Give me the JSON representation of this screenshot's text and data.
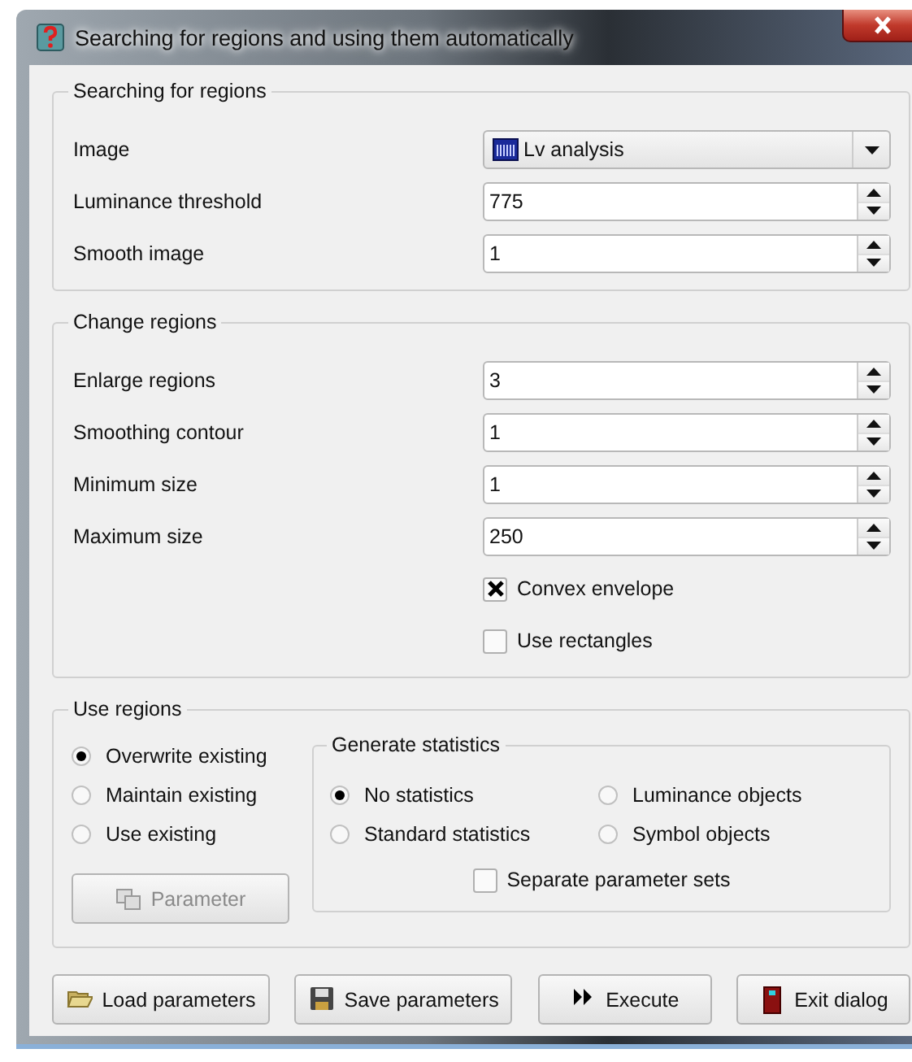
{
  "window": {
    "title": "Searching for regions and using them automatically"
  },
  "groups": [
    {
      "title": "Searching for regions",
      "rows": [
        {
          "kind": "combo",
          "label": "Image",
          "value": "Lv analysis"
        },
        {
          "kind": "spin",
          "label": "Luminance threshold",
          "value": "775"
        },
        {
          "kind": "spin",
          "label": "Smooth image",
          "value": "1"
        }
      ]
    },
    {
      "title": "Change regions",
      "rows": [
        {
          "kind": "spin",
          "label": "Enlarge regions",
          "value": "3"
        },
        {
          "kind": "spin",
          "label": "Smoothing contour",
          "value": "1"
        },
        {
          "kind": "spin",
          "label": "Minimum size",
          "value": "1"
        },
        {
          "kind": "spin",
          "label": "Maximum size",
          "value": "250"
        },
        {
          "kind": "checkbox",
          "label": "Convex envelope",
          "checked": true
        },
        {
          "kind": "checkbox",
          "label": "Use rectangles",
          "checked": false
        }
      ]
    }
  ],
  "use_regions": {
    "title": "Use regions",
    "options": [
      {
        "label": "Overwrite existing",
        "selected": true
      },
      {
        "label": "Maintain existing",
        "selected": false
      },
      {
        "label": "Use existing",
        "selected": false
      }
    ],
    "parameter_button": {
      "label": "Parameter",
      "disabled": true
    },
    "statistics": {
      "title": "Generate statistics",
      "options": [
        {
          "label": "No statistics",
          "selected": true
        },
        {
          "label": "Luminance objects",
          "selected": false
        },
        {
          "label": "Standard statistics",
          "selected": false
        },
        {
          "label": "Symbol objects",
          "selected": false
        }
      ],
      "separate": {
        "label": "Separate parameter sets",
        "checked": false
      }
    }
  },
  "buttons": [
    {
      "label": "Load parameters"
    },
    {
      "label": "Save parameters"
    },
    {
      "label": "Execute"
    },
    {
      "label": "Exit dialog"
    }
  ]
}
